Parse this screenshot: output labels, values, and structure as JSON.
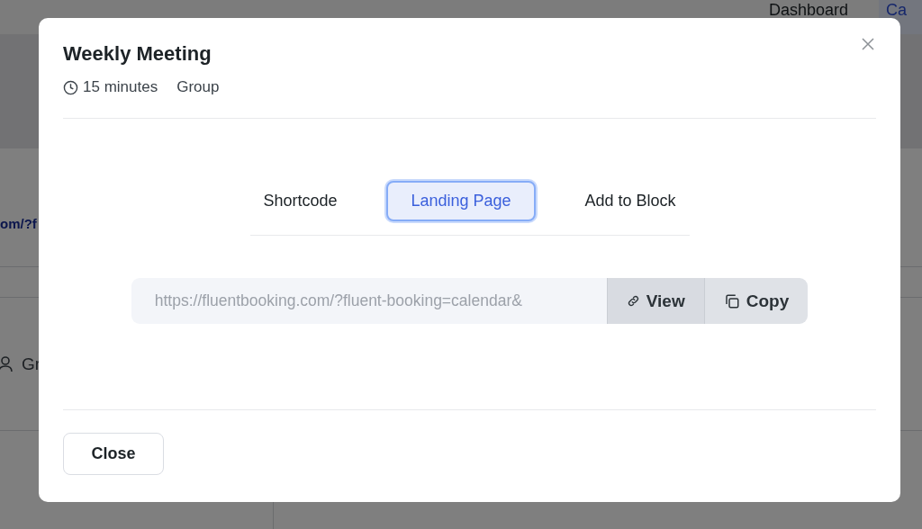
{
  "background": {
    "nav": [
      {
        "label": "Dashboard",
        "selected": false
      },
      {
        "label": "Ca",
        "selected": true
      }
    ],
    "link_fragment": "om/?f",
    "host_fragment": "Gr"
  },
  "dialog": {
    "title": "Weekly Meeting",
    "duration": "15 minutes",
    "type": "Group",
    "tabs": [
      {
        "label": "Shortcode",
        "selected": false
      },
      {
        "label": "Landing Page",
        "selected": true
      },
      {
        "label": "Add to Block",
        "selected": false
      }
    ],
    "url_field": {
      "value": "https://fluentbooking.com/?fluent-booking=calendar&"
    },
    "actions": [
      {
        "label": "View",
        "kind": "link"
      },
      {
        "label": "Copy",
        "kind": "copy"
      }
    ],
    "footer_button": "Close"
  }
}
